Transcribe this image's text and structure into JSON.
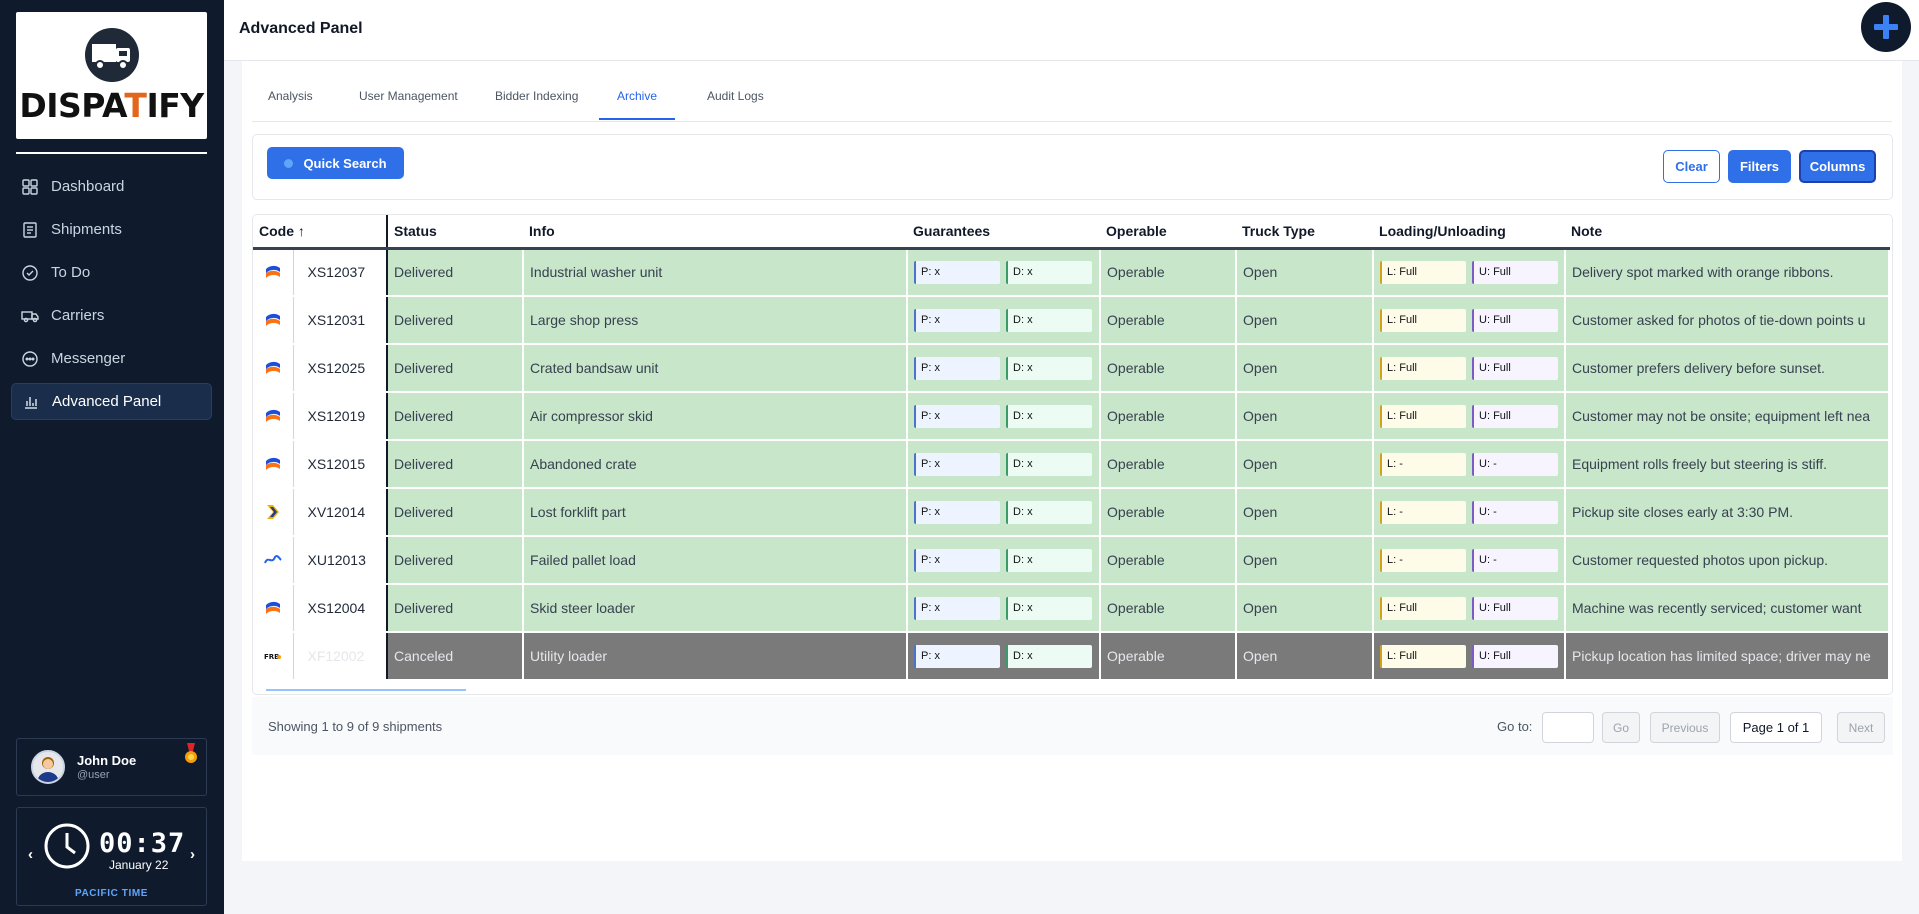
{
  "brand": {
    "logo_text_dark_1": "DISPA",
    "logo_text_orange": "T",
    "logo_text_dark_2": "IFY",
    "accent": "#e2661b"
  },
  "sidebar": {
    "items": [
      {
        "label": "Dashboard",
        "icon": "grid-icon",
        "active": false
      },
      {
        "label": "Shipments",
        "icon": "document-icon",
        "active": false
      },
      {
        "label": "To Do",
        "icon": "check-circle-icon",
        "active": false
      },
      {
        "label": "Carriers",
        "icon": "truck-icon",
        "active": false
      },
      {
        "label": "Messenger",
        "icon": "chat-icon",
        "active": false
      },
      {
        "label": "Advanced Panel",
        "icon": "bar-chart-icon",
        "active": true
      }
    ]
  },
  "user": {
    "name": "John Doe",
    "handle": "@user"
  },
  "clock": {
    "time": "00:37",
    "date": "January 22",
    "timezone": "PACIFIC TIME",
    "prev": "‹",
    "next": "›"
  },
  "header": {
    "title": "Advanced Panel"
  },
  "tabs": [
    {
      "label": "Analysis"
    },
    {
      "label": "User Management"
    },
    {
      "label": "Bidder Indexing"
    },
    {
      "label": "Archive",
      "active": true
    },
    {
      "label": "Audit Logs"
    }
  ],
  "toolbar": {
    "quick_search": "Quick Search",
    "clear": "Clear",
    "filters": "Filters",
    "columns": "Columns"
  },
  "table": {
    "columns": [
      "Code ↑",
      "Status",
      "Info",
      "Guarantees",
      "Operable",
      "Truck Type",
      "Loading/Unloading",
      "Note"
    ],
    "rows": [
      {
        "logo": "blue-orange",
        "code": "XS12037",
        "status": "Delivered",
        "info": "Industrial washer unit",
        "p": "P: x",
        "d": "D: x",
        "operable": "Operable",
        "truck": "Open",
        "l": "L: Full",
        "u": "U: Full",
        "note": "Delivery spot marked with orange ribbons."
      },
      {
        "logo": "blue-orange",
        "code": "XS12031",
        "status": "Delivered",
        "info": "Large shop press",
        "p": "P: x",
        "d": "D: x",
        "operable": "Operable",
        "truck": "Open",
        "l": "L: Full",
        "u": "U: Full",
        "note": "Customer asked for photos of tie-down points u"
      },
      {
        "logo": "blue-orange",
        "code": "XS12025",
        "status": "Delivered",
        "info": "Crated bandsaw unit",
        "p": "P: x",
        "d": "D: x",
        "operable": "Operable",
        "truck": "Open",
        "l": "L: Full",
        "u": "U: Full",
        "note": "Customer prefers delivery before sunset."
      },
      {
        "logo": "blue-orange",
        "code": "XS12019",
        "status": "Delivered",
        "info": "Air compressor skid",
        "p": "P: x",
        "d": "D: x",
        "operable": "Operable",
        "truck": "Open",
        "l": "L: Full",
        "u": "U: Full",
        "note": "Customer may not be onsite; equipment left nea"
      },
      {
        "logo": "blue-orange",
        "code": "XS12015",
        "status": "Delivered",
        "info": "Abandoned crate",
        "p": "P: x",
        "d": "D: x",
        "operable": "Operable",
        "truck": "Open",
        "l": "L: -",
        "u": "U: -",
        "note": "Equipment rolls freely but steering is stiff."
      },
      {
        "logo": "yellow-chevron",
        "code": "XV12014",
        "status": "Delivered",
        "info": "Lost forklift part",
        "p": "P: x",
        "d": "D: x",
        "operable": "Operable",
        "truck": "Open",
        "l": "L: -",
        "u": "U: -",
        "note": "Pickup site closes early at 3:30 PM."
      },
      {
        "logo": "blue-script",
        "code": "XU12013",
        "status": "Delivered",
        "info": "Failed pallet load",
        "p": "P: x",
        "d": "D: x",
        "operable": "Operable",
        "truck": "Open",
        "l": "L: -",
        "u": "U: -",
        "note": "Customer requested photos upon pickup."
      },
      {
        "logo": "blue-orange",
        "code": "XS12004",
        "status": "Delivered",
        "info": "Skid steer loader",
        "p": "P: x",
        "d": "D: x",
        "operable": "Operable",
        "truck": "Open",
        "l": "L: Full",
        "u": "U: Full",
        "note": "Machine was recently serviced; customer want"
      },
      {
        "logo": "frb",
        "code": "XF12002",
        "status": "Canceled",
        "info": "Utility loader",
        "p": "P: x",
        "d": "D: x",
        "operable": "Operable",
        "truck": "Open",
        "l": "L: Full",
        "u": "U: Full",
        "note": "Pickup location has limited space; driver may ne"
      }
    ]
  },
  "footer": {
    "showing": "Showing 1 to 9 of 9 shipments",
    "goto": "Go to:",
    "go": "Go",
    "previous": "Previous",
    "page": "Page 1 of 1",
    "next": "Next"
  },
  "colors": {
    "delivered_row": "#c8e6c9",
    "canceled_row": "#7a7a7a",
    "primary": "#2f6fe8",
    "sidebar_bg": "#0f1b2d"
  }
}
